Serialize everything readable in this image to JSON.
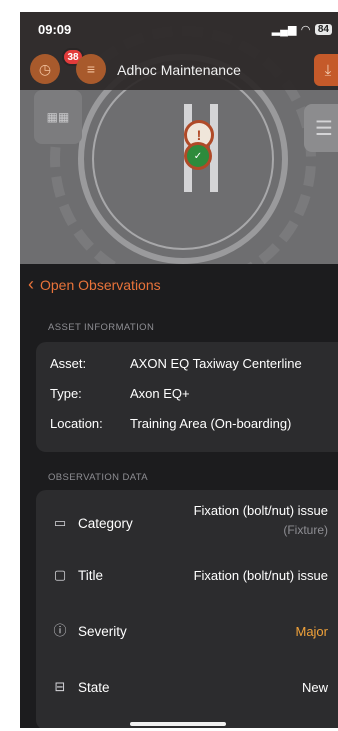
{
  "status_bar": {
    "time": "09:09",
    "signal": "▂▄▆",
    "wifi": "wifi",
    "battery": "84"
  },
  "header": {
    "title": "Adhoc Maintenance",
    "notification_count": "38"
  },
  "nav": {
    "back_label": "Open Observations"
  },
  "asset_section": {
    "header": "ASSET INFORMATION",
    "rows": [
      {
        "key": "Asset:",
        "value": "AXON EQ Taxiway Centerline"
      },
      {
        "key": "Type:",
        "value": "Axon EQ+"
      },
      {
        "key": "Location:",
        "value": "Training Area (On-boarding)"
      }
    ]
  },
  "observation_section": {
    "header": "OBSERVATION DATA",
    "rows": [
      {
        "label": "Category",
        "value": "Fixation (bolt/nut) issue",
        "sub": "(Fixture)",
        "icon": "box-icon"
      },
      {
        "label": "Title",
        "value": "Fixation (bolt/nut) issue",
        "icon": "chat-icon"
      },
      {
        "label": "Severity",
        "value": "Major",
        "icon": "info-icon"
      },
      {
        "label": "State",
        "value": "New",
        "icon": "sign-icon"
      }
    ]
  },
  "colors": {
    "accent": "#e8733a",
    "severity_major": "#f0a23a",
    "badge": "#e23b3b"
  }
}
